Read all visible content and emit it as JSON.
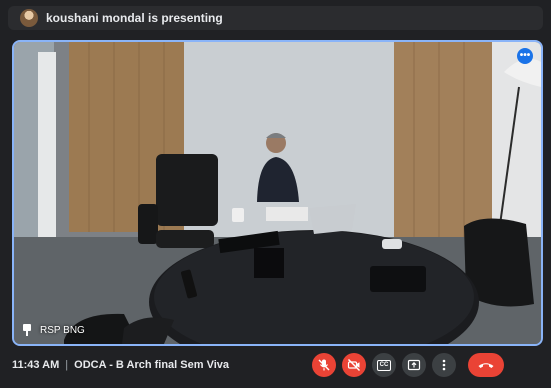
{
  "presenting_bar": {
    "text": "koushani mondal is presenting"
  },
  "tile": {
    "participant_name": "RSP BNG"
  },
  "meeting": {
    "time": "11:43 AM",
    "separator": "|",
    "title": "ODCA - B Arch final Sem Viva"
  },
  "controls": {
    "mic_icon": "mic-off-icon",
    "camera_icon": "videocam-off-icon",
    "captions_label": "CC",
    "present_icon": "present-screen-icon",
    "more_icon": "more-vert-icon",
    "end_icon": "call-end-icon"
  },
  "colors": {
    "accent": "#8ab4f8",
    "danger": "#ea4335",
    "bar_bg": "#202124"
  }
}
